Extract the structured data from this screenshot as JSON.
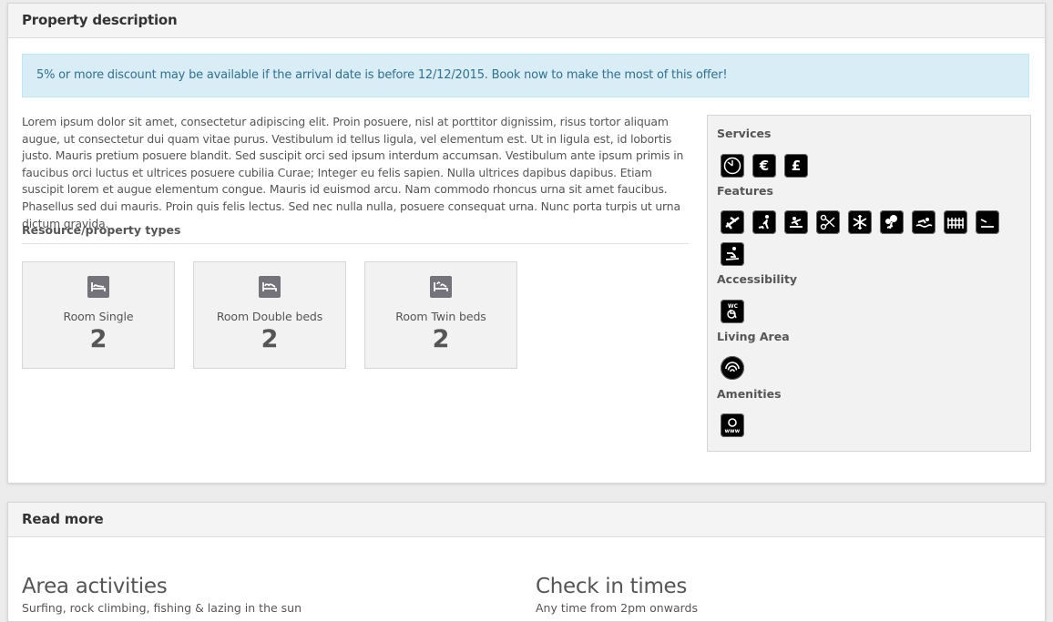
{
  "property_panel": {
    "title": "Property description",
    "alert": "5% or more discount may be available if the arrival date is before 12/12/2015. Book now to make the most of this offer!",
    "description": "Lorem ipsum dolor sit amet, consectetur adipiscing elit. Proin posuere, nisl at porttitor dignissim, risus tortor aliquam augue, ut consectetur dui quam vitae purus. Vestibulum id tellus ligula, vel elementum est. Ut in ligula est, id lobortis justo. Mauris pretium posuere blandit. Sed suscipit orci sed ipsum interdum accumsan. Vestibulum ante ipsum primis in faucibus orci luctus et ultrices posuere cubilia Curae; Integer eu felis sapien. Nulla ultrices dapibus dapibus. Etiam suscipit lorem et augue elementum congue. Mauris id euismod arcu. Nam commodo rhoncus urna sit amet faucibus. Phasellus sed dui mauris. Proin quis felis lectus. Sed nec nulla nulla, posuere consequat urna. Nunc porta turpis ut urna dictum gravida.",
    "resource_heading": "Resource/property types",
    "rooms": [
      {
        "name": "Room Single",
        "count": "2",
        "icon": "single-bed-icon"
      },
      {
        "name": "Room Double beds",
        "count": "2",
        "icon": "double-bed-icon"
      },
      {
        "name": "Room Twin beds",
        "count": "2",
        "icon": "twin-bed-icon"
      }
    ],
    "facilities": {
      "services": {
        "title": "Services",
        "icons": [
          "24h-clock-icon",
          "euro-icon",
          "pound-icon"
        ]
      },
      "features": {
        "title": "Features",
        "icons": [
          "airport-icon",
          "dog-walking-icon",
          "rowing-icon",
          "scissors-icon",
          "air-conditioning-icon",
          "garden-icon",
          "swimming-icon",
          "fence-icon",
          "hair-dryer-icon",
          "ski-icon"
        ]
      },
      "accessibility": {
        "title": "Accessibility",
        "icons": [
          "accessible-wc-icon"
        ]
      },
      "living_area": {
        "title": "Living Area",
        "icons": [
          "wifi-icon"
        ]
      },
      "amenities": {
        "title": "Amenities",
        "icons": [
          "internet-www-icon"
        ]
      }
    }
  },
  "read_more_panel": {
    "title": "Read more",
    "area_activities": {
      "heading": "Area activities",
      "text": "Surfing, rock climbing, fishing & lazing in the sun"
    },
    "check_in": {
      "heading": "Check in times",
      "text": "Any time from 2pm onwards"
    }
  }
}
